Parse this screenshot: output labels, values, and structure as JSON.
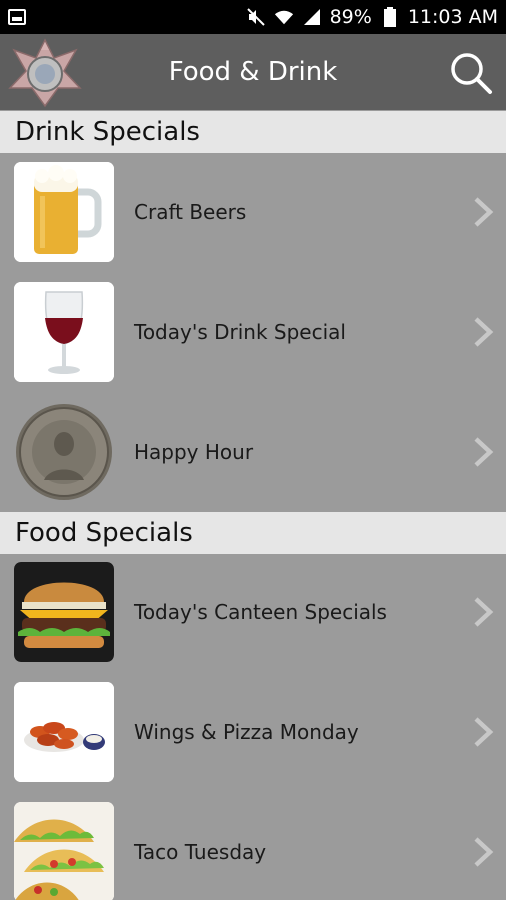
{
  "status_bar": {
    "battery": "89%",
    "time": "11:03 AM"
  },
  "app_bar": {
    "title": "Food & Drink"
  },
  "sections": [
    {
      "header": "Drink Specials",
      "items": [
        {
          "label": "Craft Beers",
          "icon": "beer-mug-icon"
        },
        {
          "label": "Today's Drink Special",
          "icon": "wine-glass-icon"
        },
        {
          "label": "Happy Hour",
          "icon": "coin-icon"
        }
      ]
    },
    {
      "header": "Food Specials",
      "items": [
        {
          "label": "Today's Canteen Specials",
          "icon": "burger-icon"
        },
        {
          "label": "Wings & Pizza Monday",
          "icon": "wings-icon"
        },
        {
          "label": "Taco Tuesday",
          "icon": "tacos-icon"
        }
      ]
    }
  ],
  "colors": {
    "status_bar": "#000000",
    "app_bar": "#5e5e5e",
    "list_background": "#9b9b9b",
    "section_header": "#e6e6e6"
  }
}
